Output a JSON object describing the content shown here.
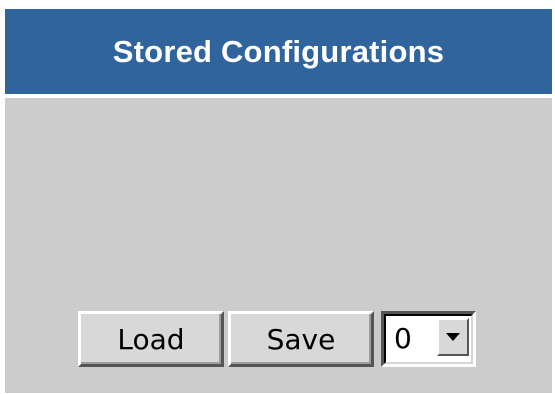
{
  "panel": {
    "title": "Stored Configurations",
    "header_color": "#30649c",
    "background_color": "#cccccc"
  },
  "controls": {
    "load_label": "Load",
    "save_label": "Save",
    "slot_select": {
      "selected_value": "0",
      "arrow_icon": "chevron-down-icon"
    }
  }
}
